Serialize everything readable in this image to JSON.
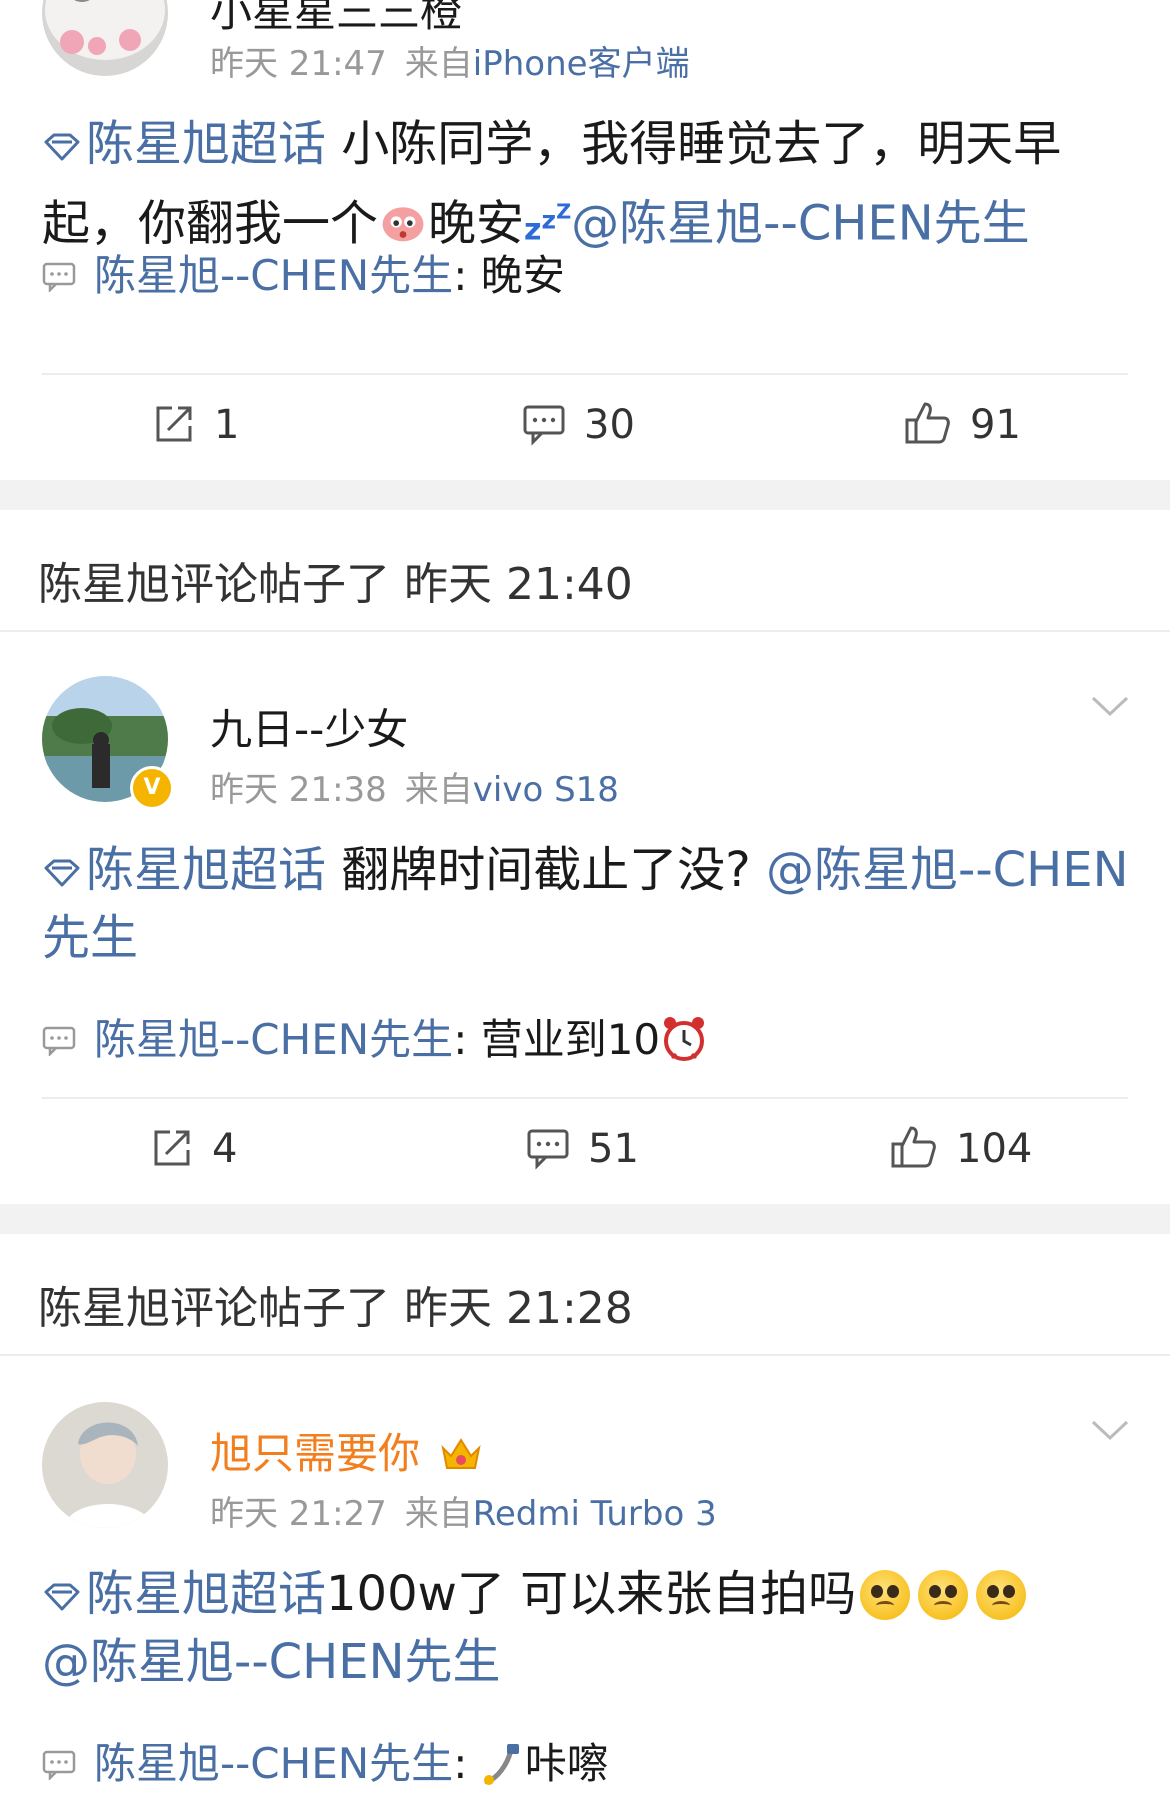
{
  "posts": [
    {
      "username": "小星星三三橙",
      "time": "昨天 21:47",
      "source_prefix": "来自",
      "source": "iPhone客户端",
      "supertopic": "陈星旭超话",
      "text_before": " 小陈同学，我得睡觉去了，明天早起，你翻我一个",
      "text_mid": "晚安",
      "mention": "@陈星旭--CHEN先生",
      "reply_author": "陈星旭--CHEN先生",
      "reply_text": "晚安",
      "reposts": "1",
      "comments": "30",
      "likes": "91"
    },
    {
      "section_header": "陈星旭评论帖子了 昨天 21:40",
      "username": "九日--少女",
      "time": "昨天 21:38",
      "source_prefix": "来自",
      "source": "vivo S18",
      "supertopic": "陈星旭超话",
      "text_before": " 翻牌时间截止了没? ",
      "mention": "@陈星旭--CHEN先生",
      "reply_author": "陈星旭--CHEN先生",
      "reply_text": "营业到10",
      "reposts": "4",
      "comments": "51",
      "likes": "104"
    },
    {
      "section_header": "陈星旭评论帖子了 昨天 21:28",
      "username": "旭只需要你",
      "time": "昨天 21:27",
      "source_prefix": "来自",
      "source": "Redmi Turbo 3",
      "supertopic": "陈星旭超话",
      "text_before": "100w了  可以来张自拍吗",
      "mention": "@陈星旭--CHEN先生",
      "reply_author": "陈星旭--CHEN先生",
      "reply_text": "咔嚓"
    }
  ],
  "colors": {
    "link": "#4a6fa5",
    "meta": "#999999",
    "vip_name": "#f27e1e",
    "band": "#f2f2f2"
  },
  "icons": [
    "repost-icon",
    "comment-icon",
    "like-icon",
    "supertopic-icon",
    "chevron-down-icon",
    "verified-badge-icon",
    "crown-icon",
    "sleep-emoji",
    "alarm-clock-emoji",
    "pleading-emoji",
    "selfie-stick-emoji"
  ]
}
